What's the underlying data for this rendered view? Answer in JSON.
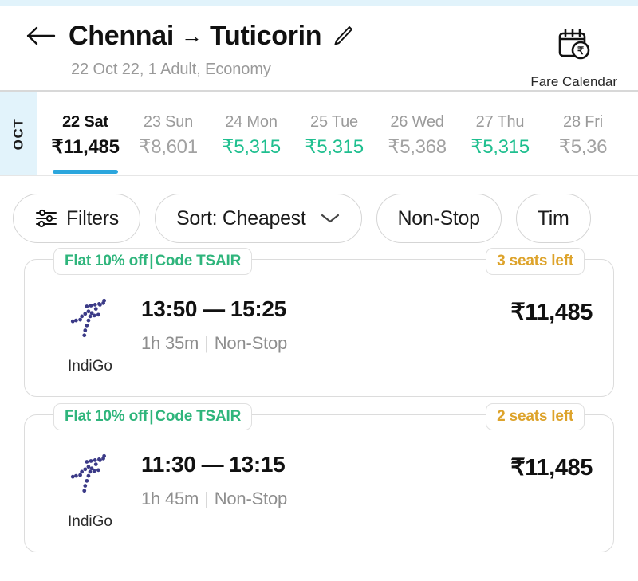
{
  "header": {
    "back_icon": "arrow-left-icon",
    "origin": "Chennai",
    "arrow": "→",
    "destination": "Tuticorin",
    "edit_icon": "pencil-edit-icon",
    "subtitle": "22 Oct 22, 1 Adult, Economy",
    "fare_calendar_label": "Fare Calendar",
    "fare_calendar_icon": "calendar-rupee-icon"
  },
  "date_strip": {
    "month": "OCT",
    "dates": [
      {
        "day": "22 Sat",
        "price": "₹11,485",
        "state": "active"
      },
      {
        "day": "23 Sun",
        "price": "₹8,601",
        "state": "normal"
      },
      {
        "day": "24 Mon",
        "price": "₹5,315",
        "state": "cheap"
      },
      {
        "day": "25 Tue",
        "price": "₹5,315",
        "state": "cheap"
      },
      {
        "day": "26 Wed",
        "price": "₹5,368",
        "state": "normal"
      },
      {
        "day": "27 Thu",
        "price": "₹5,315",
        "state": "cheap"
      },
      {
        "day": "28 Fri",
        "price": "₹5,36",
        "state": "normal"
      }
    ]
  },
  "filters": {
    "filters_label": "Filters",
    "filters_icon": "tune-sliders-icon",
    "sort_label": "Sort: Cheapest",
    "sort_chevron_icon": "chevron-down-icon",
    "nonstop_label": "Non-Stop",
    "timing_label": "Tim"
  },
  "flights": [
    {
      "offer_text_1": "Flat 10% off",
      "offer_sep": "|",
      "offer_text_2": "Code TSAIR",
      "seats_left": "3 seats left",
      "airline": "IndiGo",
      "airline_logo_icon": "indigo-dotted-plane-icon",
      "depart_time": "13:50",
      "time_dash": "—",
      "arrive_time": "15:25",
      "duration": "1h 35m",
      "meta_pipe": "|",
      "stops": "Non-Stop",
      "price": "₹11,485"
    },
    {
      "offer_text_1": "Flat 10% off",
      "offer_sep": "|",
      "offer_text_2": "Code TSAIR",
      "seats_left": "2 seats left",
      "airline": "IndiGo",
      "airline_logo_icon": "indigo-dotted-plane-icon",
      "depart_time": "11:30",
      "time_dash": "—",
      "arrive_time": "13:15",
      "duration": "1h 45m",
      "meta_pipe": "|",
      "stops": "Non-Stop",
      "price": "₹11,485"
    }
  ],
  "colors": {
    "accent_blue": "#2ba6dd",
    "cheap_green": "#1fbf8f",
    "offer_green": "#2fb57c",
    "seats_amber": "#dda32b",
    "month_bg": "#e2f3fb",
    "indigo_logo": "#3b3a87"
  }
}
